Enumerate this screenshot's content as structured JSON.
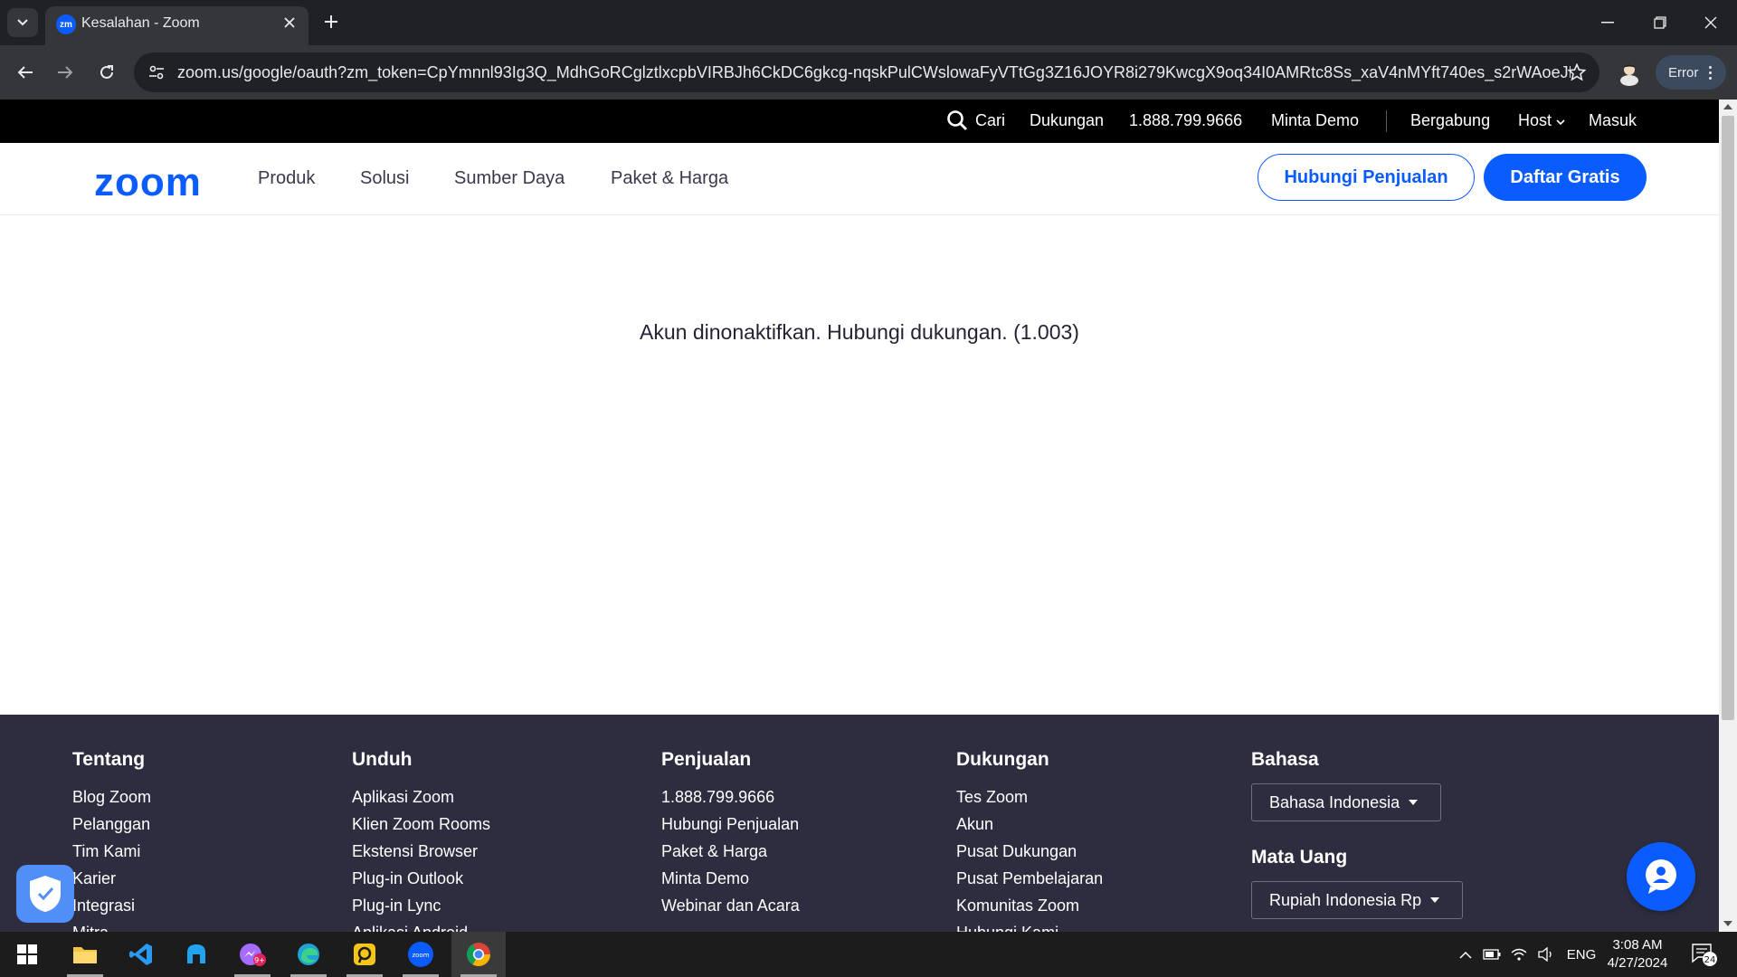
{
  "browser": {
    "tab_title": "Kesalahan - Zoom",
    "tab_favicon_text": "zm",
    "url": "zoom.us/google/oauth?zm_token=CpYmnnl93Ig3Q_MdhGoRCglztlxcpbVIRBJh6CkDC6gkcg-nqskPulCWslowaFyVTtGg3Z16JOYR8i279KwcgX9oq34I0AMRtc8Ss_xaV4nMYft740es_s2rWAoeJBZxh5q9J...",
    "error_chip": "Error"
  },
  "topbar": {
    "search": "Cari",
    "support": "Dukungan",
    "phone": "1.888.799.9666",
    "demo": "Minta Demo",
    "join": "Bergabung",
    "host": "Host",
    "signin": "Masuk"
  },
  "nav": {
    "logo": "zoom",
    "links": [
      "Produk",
      "Solusi",
      "Sumber Daya",
      "Paket & Harga"
    ],
    "contact_sales": "Hubungi Penjualan",
    "signup_free": "Daftar Gratis"
  },
  "main": {
    "error_message": "Akun dinonaktifkan. Hubungi dukungan. (1.003)"
  },
  "footer": {
    "columns": [
      {
        "heading": "Tentang",
        "links": [
          "Blog Zoom",
          "Pelanggan",
          "Tim Kami",
          "Karier",
          "Integrasi",
          "Mitra"
        ]
      },
      {
        "heading": "Unduh",
        "links": [
          "Aplikasi Zoom",
          "Klien Zoom Rooms",
          "Ekstensi Browser",
          "Plug-in Outlook",
          "Plug-in Lync",
          "Aplikasi Android"
        ]
      },
      {
        "heading": "Penjualan",
        "links": [
          "1.888.799.9666",
          "Hubungi Penjualan",
          "Paket & Harga",
          "Minta Demo",
          "Webinar dan Acara"
        ]
      },
      {
        "heading": "Dukungan",
        "links": [
          "Tes Zoom",
          "Akun",
          "Pusat Dukungan",
          "Pusat Pembelajaran",
          "Komunitas Zoom",
          "Hubungi Kami"
        ]
      }
    ],
    "language_heading": "Bahasa",
    "language_value": "Bahasa Indonesia",
    "currency_heading": "Mata Uang",
    "currency_value": "Rupiah Indonesia Rp"
  },
  "taskbar": {
    "apps": [
      "windows-start",
      "file-explorer",
      "vs-code",
      "app-blue",
      "messenger",
      "edge",
      "app-yellow",
      "zoom",
      "chrome"
    ],
    "zoom_icon_text": "zoom",
    "messenger_badge": "9+",
    "language": "ENG",
    "time": "3:08 AM",
    "date": "4/27/2024",
    "notification_count": "24"
  },
  "colors": {
    "brand_blue": "#0b5cff",
    "topbar_bg": "#000000",
    "footer_bg": "#2d2d3f",
    "chrome_dark": "#202124",
    "chrome_toolbar": "#35363a"
  }
}
